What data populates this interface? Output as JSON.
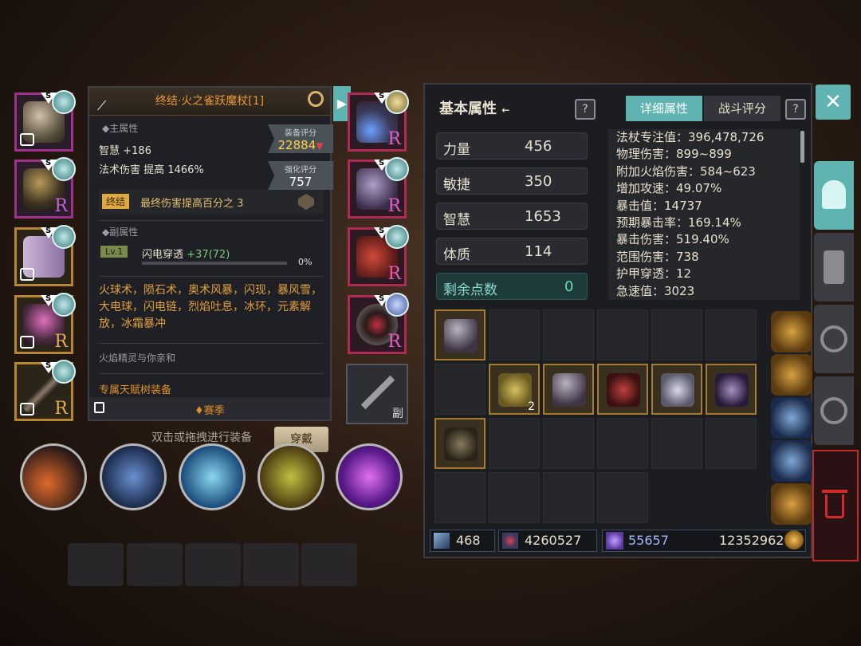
{
  "left_equipment": [
    {
      "name": "helmet",
      "rarity": "",
      "locked": true
    },
    {
      "name": "chest",
      "rarity": "R",
      "locked": false
    },
    {
      "name": "robe",
      "rarity": "",
      "locked": true
    },
    {
      "name": "offhand",
      "rarity": "R",
      "locked": true
    },
    {
      "name": "staff",
      "rarity": "R",
      "locked": true
    }
  ],
  "right_equipment": [
    {
      "name": "necklace",
      "rarity": "R"
    },
    {
      "name": "gloves",
      "rarity": "R"
    },
    {
      "name": "boots",
      "rarity": "R"
    },
    {
      "name": "ring",
      "rarity": "R"
    }
  ],
  "slot_badge": "S",
  "tooltip": {
    "title": "终结·火之雀跃魔杖[1]",
    "main_attr_header": "◆主属性",
    "attr1": "智慧 +186",
    "attr2": "法术伤害 提高 1466%",
    "gear_score_label": "装备评分",
    "gear_score_value": "22884",
    "enhance_score_label": "强化评分",
    "enhance_score_value": "757",
    "finale_tag": "终结",
    "finale_text": "最终伤害提高百分之 3",
    "sub_attr_header": "◆副属性",
    "sub_level": "Lv.1",
    "sub_name": "闪电穿透",
    "sub_bonus": "+37(72)",
    "sub_progress": "0%",
    "skills_text": "火球术，陨石术，奥术风暴，闪现，暴风雪，大电球，闪电链，烈焰吐息，冰环，元素解放，冰霜暴冲",
    "affinity": "火焰精灵与你亲和",
    "talent": "专属天赋树装备",
    "season": "♦赛季"
  },
  "equip_hint": "双击或拖拽进行装备",
  "wear_button": "穿戴",
  "offhand_label": "副",
  "stats": {
    "header": "基本属性",
    "header_arrow": "←",
    "tab_detail": "详细属性",
    "tab_battle": "战斗评分",
    "help": "?",
    "rows": [
      {
        "k": "力量",
        "v": "456"
      },
      {
        "k": "敏捷",
        "v": "350"
      },
      {
        "k": "智慧",
        "v": "1653"
      },
      {
        "k": "体质",
        "v": "114"
      }
    ],
    "remaining_label": "剩余点数",
    "remaining_value": "0",
    "detail": [
      "法杖专注值：396,478,726",
      "物理伤害：899~899",
      "附加火焰伤害：584~623",
      "增加攻速：49.07%",
      "暴击值：14737",
      "预期暴击率：169.14%",
      "暴击伤害：519.40%",
      "范围伤害：738",
      "护甲穿透：12",
      "急速值：3023"
    ]
  },
  "inventory": {
    "stack_count": "2"
  },
  "currency": {
    "c1": "468",
    "c2": "4260527",
    "c3": "55657",
    "gold": "12352962"
  },
  "close": "✕",
  "colors": {
    "accent_teal": "#5fb3b0",
    "gold": "#e0b050",
    "red": "#d6412d"
  }
}
